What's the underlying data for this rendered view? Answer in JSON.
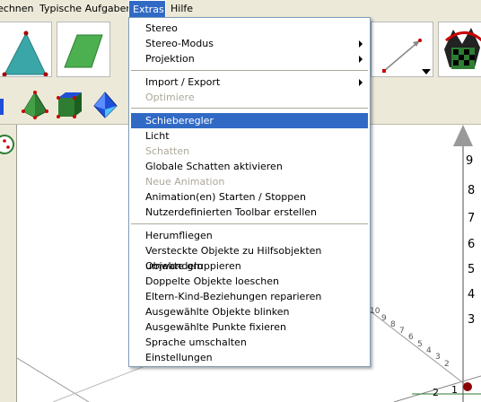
{
  "menubar": {
    "items": [
      "echnen",
      "Typische Aufgaben",
      "Extras",
      "Hilfe"
    ]
  },
  "extras_menu": {
    "items": [
      {
        "label": "Stereo",
        "enabled": true,
        "submenu": false
      },
      {
        "label": "Stereo-Modus",
        "enabled": true,
        "submenu": true
      },
      {
        "label": "Projektion",
        "enabled": true,
        "submenu": true
      },
      {
        "label": "Import / Export",
        "enabled": true,
        "submenu": true
      },
      {
        "label": "Optimiere",
        "enabled": false,
        "submenu": false
      },
      {
        "label": "Schieberegler",
        "enabled": true,
        "submenu": false,
        "highlighted": true
      },
      {
        "label": "Licht",
        "enabled": true,
        "submenu": false
      },
      {
        "label": "Schatten",
        "enabled": false,
        "submenu": false
      },
      {
        "label": "Globale Schatten aktivieren",
        "enabled": true,
        "submenu": false
      },
      {
        "label": "Neue Animation",
        "enabled": false,
        "submenu": false
      },
      {
        "label": "Animation(en) Starten / Stoppen",
        "enabled": true,
        "submenu": false
      },
      {
        "label": "Nutzerdefinierten Toolbar erstellen",
        "enabled": true,
        "submenu": false
      },
      {
        "label": "Herumfliegen",
        "enabled": true,
        "submenu": false
      },
      {
        "label": "Versteckte Objekte zu Hilfsobjekten umwandeln",
        "enabled": true,
        "submenu": false
      },
      {
        "label": "Objekte gruppieren",
        "enabled": true,
        "submenu": false
      },
      {
        "label": "Doppelte Objekte loeschen",
        "enabled": true,
        "submenu": false
      },
      {
        "label": "Eltern-Kind-Beziehungen reparieren",
        "enabled": true,
        "submenu": false
      },
      {
        "label": "Ausgewählte Objekte blinken",
        "enabled": true,
        "submenu": false
      },
      {
        "label": "Ausgewählte Punkte fixieren",
        "enabled": true,
        "submenu": false
      },
      {
        "label": "Sprache umschalten",
        "enabled": true,
        "submenu": false
      },
      {
        "label": "Einstellungen",
        "enabled": true,
        "submenu": false
      }
    ]
  },
  "axis": {
    "vertical_ticks": [
      "9",
      "8",
      "7",
      "6",
      "5",
      "4",
      "3"
    ],
    "diagonal_ticks": [
      "10",
      "9",
      "8",
      "7",
      "6",
      "5",
      "4",
      "3",
      "2"
    ],
    "bottom_ticks": [
      "2",
      "1"
    ]
  },
  "colors": {
    "menu_highlight": "#316ac5",
    "triangle": "#3aa6a8",
    "parallelogram": "#4caf50",
    "axis_point": "#8b0000"
  }
}
